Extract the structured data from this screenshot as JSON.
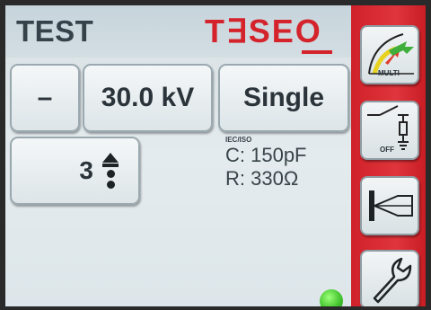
{
  "header": {
    "title": "TEST",
    "logo_text": "T∃SEO"
  },
  "controls": {
    "minus_label": "–",
    "voltage_label": "30.0 kV",
    "mode_label": "Single",
    "count_value": "3"
  },
  "network": {
    "standard_label": "IEC/ISO",
    "capacitance": "C: 150pF",
    "resistance": "R: 330Ω"
  },
  "side_panel": {
    "multi_label": "MULTI",
    "off_label": "OFF"
  },
  "colors": {
    "accent_red": "#d4232b",
    "status_green": "#43c52e"
  },
  "icons": [
    "multi-polarity-icon",
    "discharge-switch-icon",
    "probe-tip-icon",
    "wrench-icon",
    "up-down-arrow-icon"
  ]
}
